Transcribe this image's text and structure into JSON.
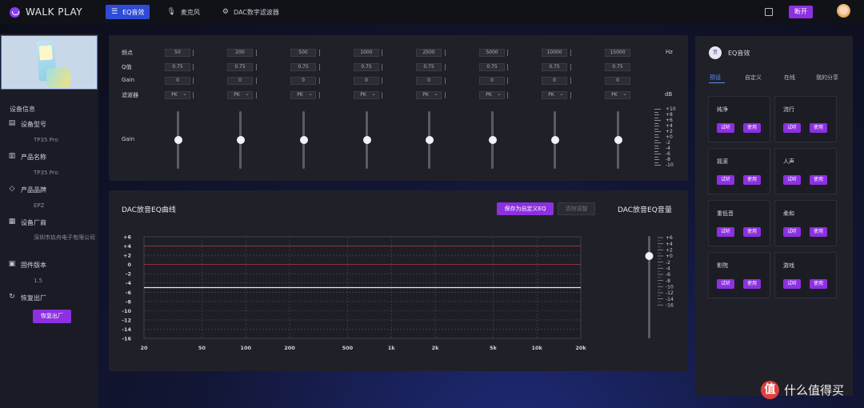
{
  "app": {
    "logo_text": "WALK PLAY"
  },
  "topbar": {
    "tabs": [
      {
        "label": "EQ音效",
        "icon": "sliders-icon",
        "active": true
      },
      {
        "label": "麦克风",
        "icon": "microphone-icon",
        "active": false
      },
      {
        "label": "DAC数字滤波器",
        "icon": "gear-icon",
        "active": false
      }
    ],
    "disconnect_label": "断开"
  },
  "device": {
    "section_title": "设备信息",
    "fields": [
      {
        "label": "设备型号",
        "value": "TP35 Pro",
        "icon": "device-icon"
      },
      {
        "label": "产品名称",
        "value": "TP35 Pro",
        "icon": "building-icon"
      },
      {
        "label": "产品品牌",
        "value": "EPZ",
        "icon": "tag-icon"
      },
      {
        "label": "设备厂商",
        "value": "深圳市玖舟电子有限公司",
        "icon": "factory-icon"
      },
      {
        "label": "固件版本",
        "value": "1.5",
        "icon": "chip-icon"
      },
      {
        "label": "恢复出厂",
        "value": "",
        "icon": "refresh-icon"
      }
    ],
    "reset_button": "恢复出厂"
  },
  "eq": {
    "row_labels": {
      "freq": "频点",
      "q": "Q值",
      "gain": "Gain",
      "filter": "滤波器",
      "gain_slider": "Gain"
    },
    "units": {
      "freq": "Hz",
      "gain": "dB"
    },
    "bands": [
      {
        "freq": "50",
        "q": "0.75",
        "gain": "0",
        "filter": "PK"
      },
      {
        "freq": "200",
        "q": "0.75",
        "gain": "0",
        "filter": "PK"
      },
      {
        "freq": "500",
        "q": "0.75",
        "gain": "0",
        "filter": "PK"
      },
      {
        "freq": "1000",
        "q": "0.75",
        "gain": "0",
        "filter": "PK"
      },
      {
        "freq": "2500",
        "q": "0.75",
        "gain": "0",
        "filter": "PK"
      },
      {
        "freq": "5000",
        "q": "0.75",
        "gain": "0",
        "filter": "PK"
      },
      {
        "freq": "10000",
        "q": "0.75",
        "gain": "0",
        "filter": "PK"
      },
      {
        "freq": "15000",
        "q": "0.75",
        "gain": "0",
        "filter": "PK"
      }
    ],
    "scale": [
      "+10",
      "+8",
      "+6",
      "+4",
      "+2",
      "+0",
      "-2",
      "-4",
      "-6",
      "-8",
      "-10"
    ]
  },
  "curve": {
    "title": "DAC放音EQ曲线",
    "save_button": "保存为自定义EQ",
    "clear_button": "清除调整",
    "volume_title": "DAC放音EQ音量",
    "volume_scale": [
      "+6",
      "+4",
      "+2",
      "+0",
      "-2",
      "-4",
      "-6",
      "-8",
      "-10",
      "-12",
      "-14",
      "-16"
    ],
    "volume_level_db": 0
  },
  "chart_data": {
    "type": "line",
    "title": "DAC放音EQ曲线",
    "x_scale": "log",
    "x_ticks": [
      "20",
      "50",
      "100",
      "200",
      "500",
      "1k",
      "2k",
      "5k",
      "10k",
      "20k"
    ],
    "y_ticks": [
      "+6",
      "+4",
      "+2",
      "0",
      "-2",
      "-4",
      "-6",
      "-8",
      "-10",
      "-12",
      "-14",
      "-16"
    ],
    "ylim": [
      -16,
      6
    ],
    "xlim": [
      20,
      20000
    ],
    "reference_lines": [
      4,
      0
    ],
    "grid": true,
    "series": [
      {
        "x": [
          20,
          50,
          100,
          200,
          500,
          1000,
          2000,
          5000,
          10000,
          20000
        ],
        "y": [
          -5,
          -5,
          -5,
          -5,
          -5,
          -5,
          -5,
          -5,
          -5,
          -5
        ]
      }
    ]
  },
  "presets": {
    "icon_text": "音",
    "title": "EQ音效",
    "tabs": [
      {
        "label": "预设",
        "active": true
      },
      {
        "label": "自定义",
        "active": false
      },
      {
        "label": "在线",
        "active": false
      },
      {
        "label": "我的分享",
        "active": false
      }
    ],
    "try_label": "试听",
    "use_label": "使用",
    "items": [
      "纯净",
      "流行",
      "摇滚",
      "人声",
      "重低音",
      "柔和",
      "影院",
      "游戏"
    ]
  },
  "watermark": {
    "logo": "值",
    "text": "什么值得买"
  },
  "colors": {
    "accent": "#8c30e0",
    "tab_active": "#2f4bd6",
    "link_active": "#5a8cff"
  }
}
